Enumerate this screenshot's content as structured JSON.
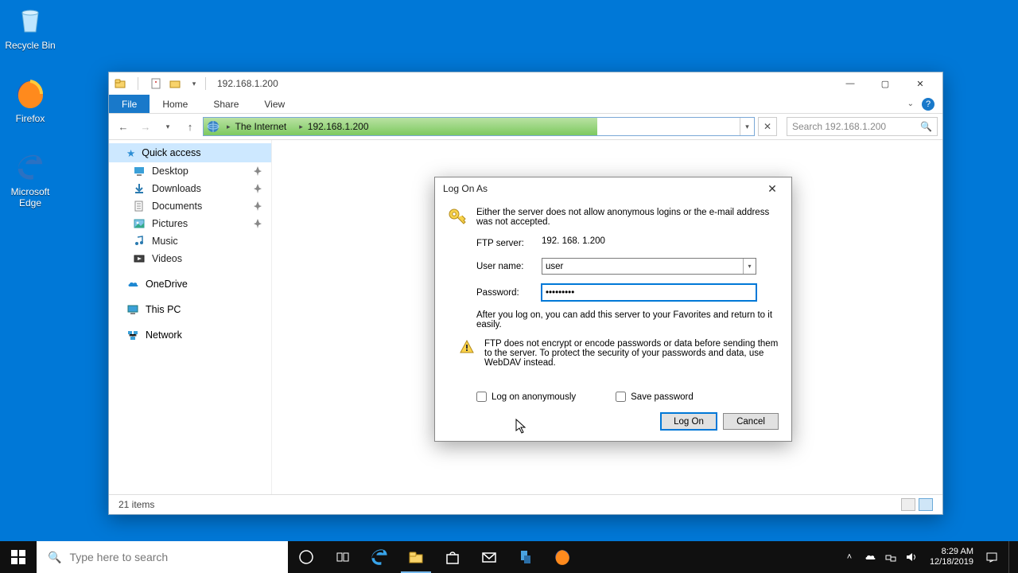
{
  "desktop": {
    "recycle": "Recycle Bin",
    "firefox": "Firefox",
    "edge": "Microsoft Edge"
  },
  "window": {
    "title": "192.168.1.200",
    "tabs": {
      "file": "File",
      "home": "Home",
      "share": "Share",
      "view": "View"
    },
    "breadcrumb": {
      "internet": "The Internet",
      "host": "192.168.1.200"
    },
    "search_placeholder": "Search 192.168.1.200",
    "status": "21 items"
  },
  "sidebar": {
    "quick_access": "Quick access",
    "items": [
      {
        "label": "Desktop"
      },
      {
        "label": "Downloads"
      },
      {
        "label": "Documents"
      },
      {
        "label": "Pictures"
      },
      {
        "label": "Music"
      },
      {
        "label": "Videos"
      }
    ],
    "onedrive": "OneDrive",
    "thispc": "This PC",
    "network": "Network"
  },
  "dialog": {
    "title": "Log On As",
    "msg1": "Either the server does not allow anonymous logins or the e-mail address was not accepted.",
    "ftp_label": "FTP server:",
    "ftp_value": "192. 168. 1.200",
    "user_label": "User name:",
    "user_value": "user",
    "pass_label": "Password:",
    "pass_value": "●●●●●●●●●",
    "msg2": "After you log on, you can add this server to your Favorites and return to it easily.",
    "msg3": "FTP does not encrypt or encode passwords or data before sending them to the server.  To protect the security of your passwords and data, use WebDAV instead.",
    "chk_anon": "Log on anonymously",
    "chk_save": "Save password",
    "btn_logon": "Log On",
    "btn_cancel": "Cancel"
  },
  "taskbar": {
    "search_placeholder": "Type here to search",
    "time": "8:29 AM",
    "date": "12/18/2019"
  }
}
